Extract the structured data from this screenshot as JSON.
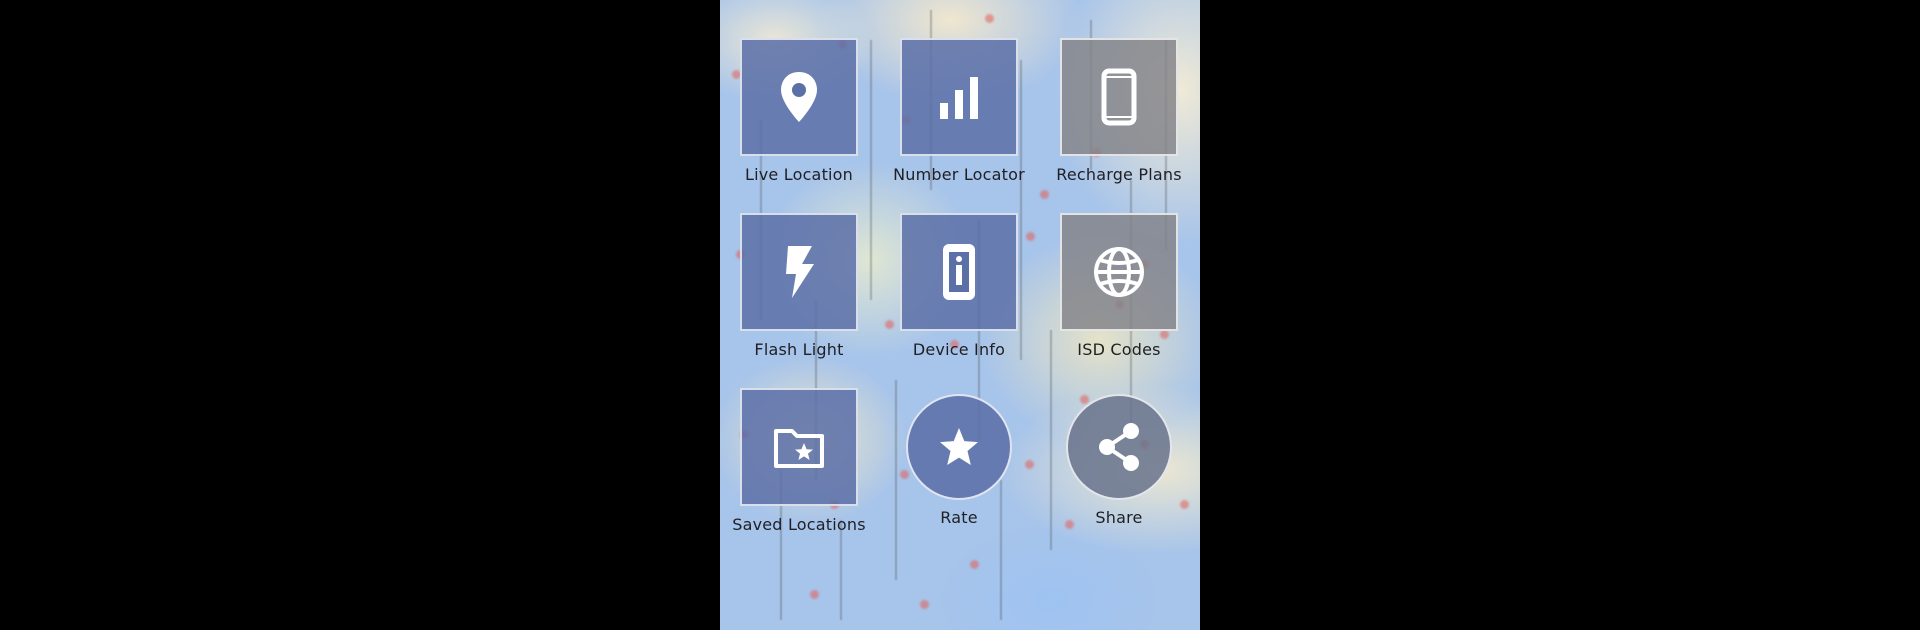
{
  "menu": {
    "items": [
      {
        "id": "live-location",
        "label": "Live Location",
        "icon": "location-pin-icon"
      },
      {
        "id": "number-locator",
        "label": "Number Locator",
        "icon": "signal-bars-icon"
      },
      {
        "id": "recharge-plans",
        "label": "Recharge Plans",
        "icon": "smartphone-icon"
      },
      {
        "id": "flash-light",
        "label": "Flash Light",
        "icon": "lightning-bolt-icon"
      },
      {
        "id": "device-info",
        "label": "Device Info",
        "icon": "device-info-icon"
      },
      {
        "id": "isd-codes",
        "label": "ISD Codes",
        "icon": "globe-icon"
      },
      {
        "id": "saved-locations",
        "label": "Saved Locations",
        "icon": "starred-folder-icon"
      },
      {
        "id": "rate",
        "label": "Rate",
        "icon": "star-icon"
      },
      {
        "id": "share",
        "label": "Share",
        "icon": "share-icon"
      }
    ]
  },
  "colors": {
    "tile_blue": "#5c70a8",
    "tile_grey": "#828287",
    "label_text": "#1f1f24",
    "backdrop": "#000000",
    "map_water": "#a7c4ea"
  }
}
